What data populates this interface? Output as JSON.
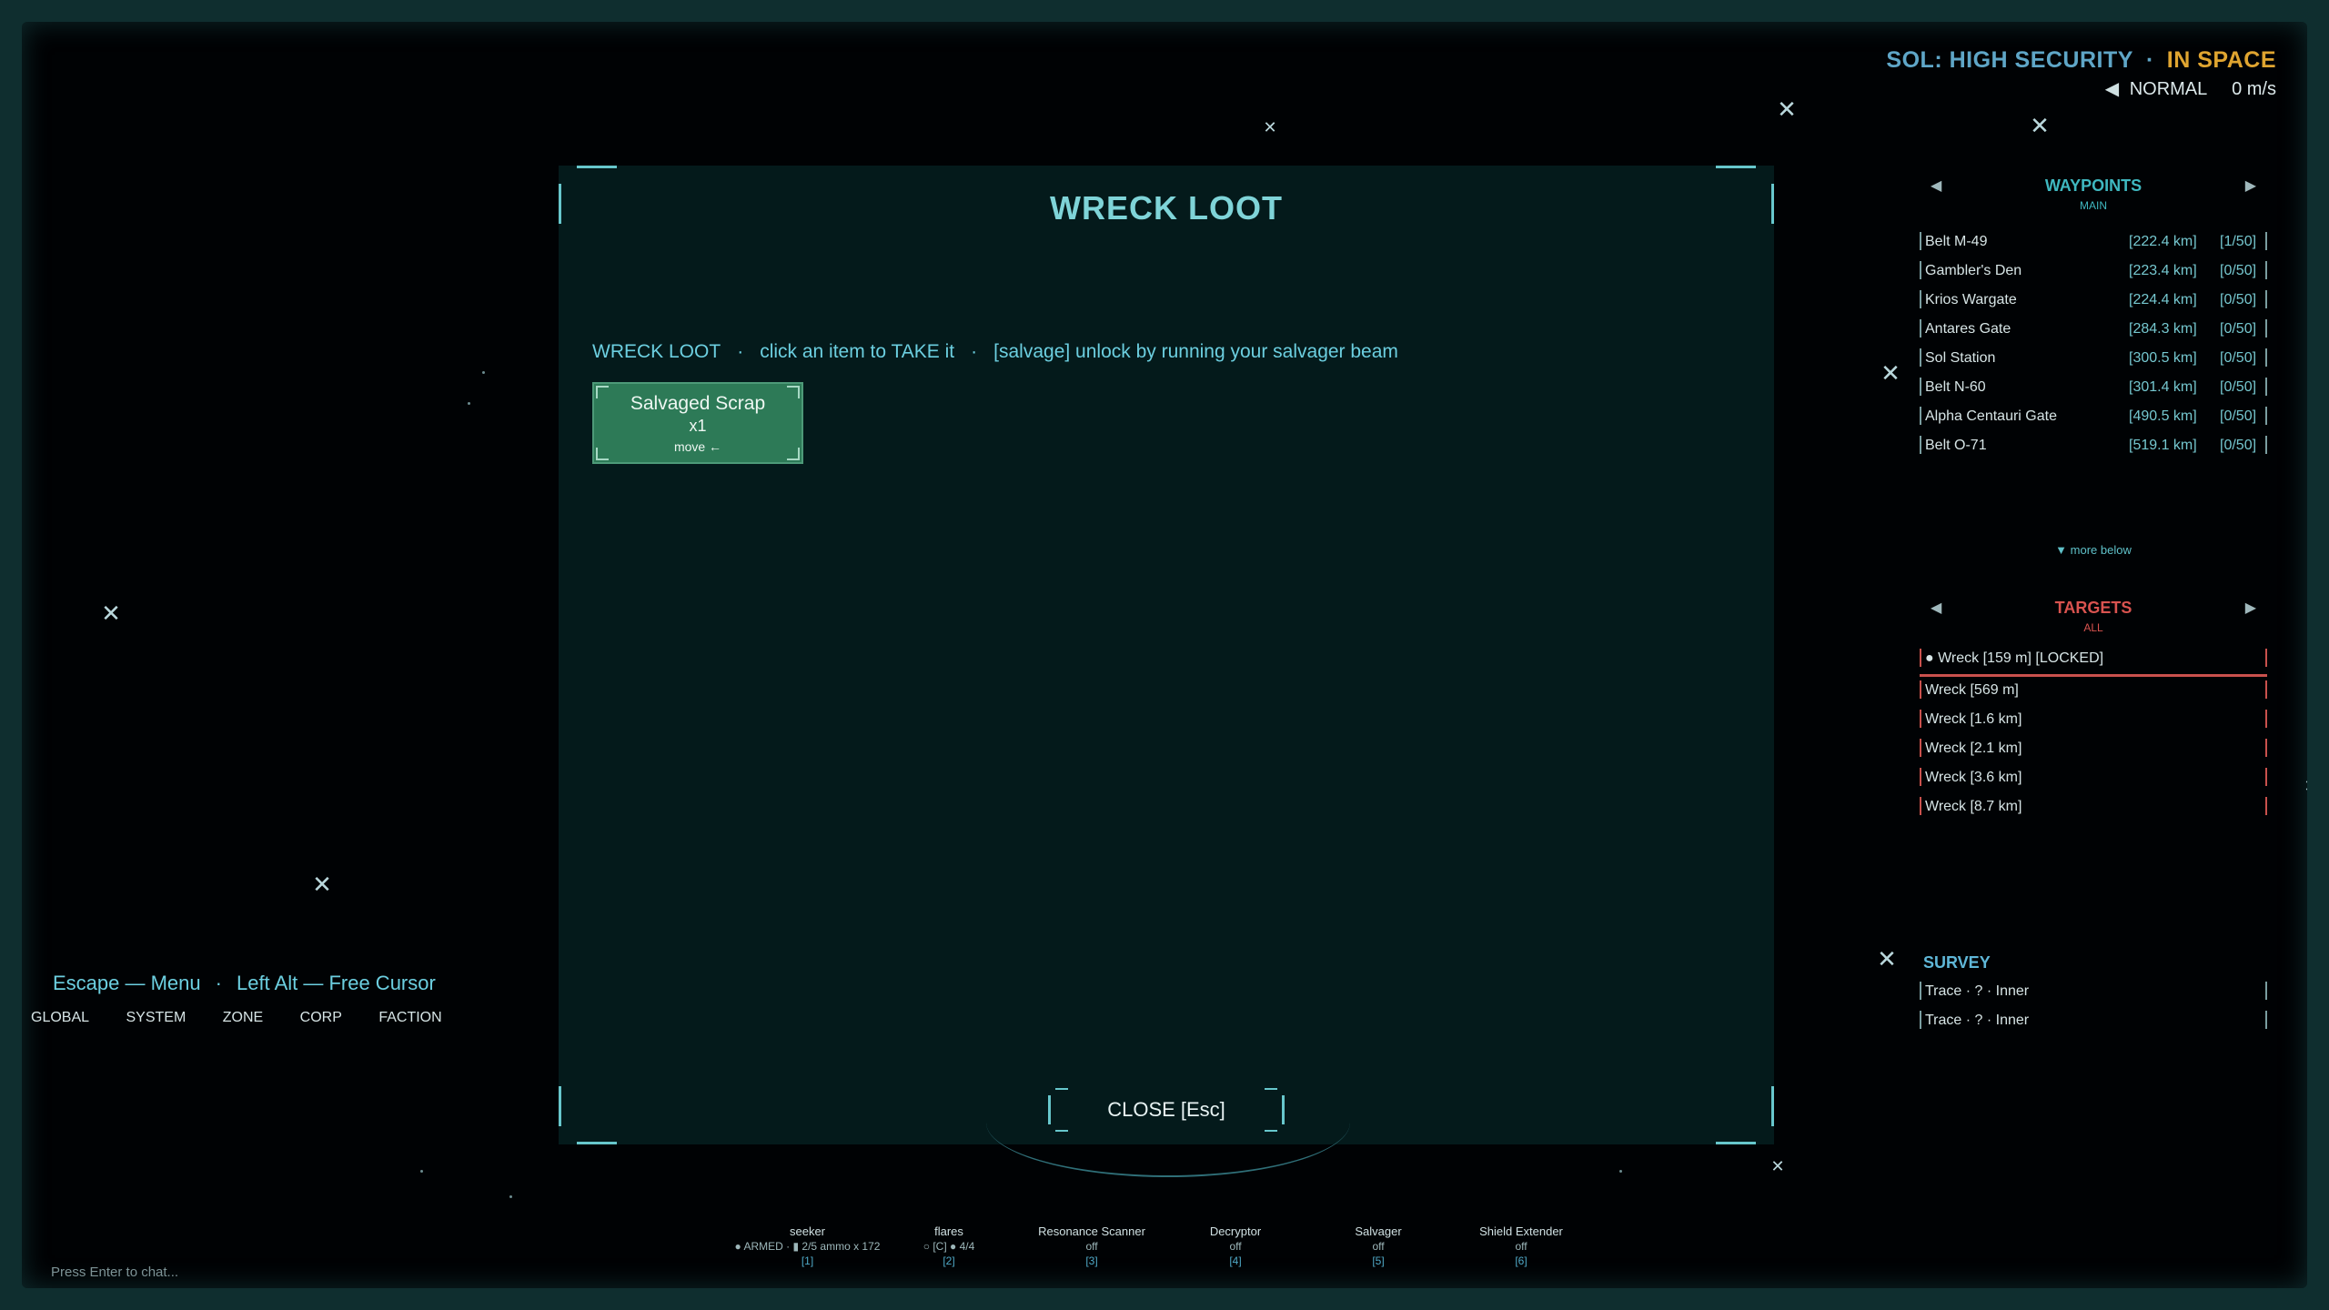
{
  "system": {
    "name": "SOL: HIGH SECURITY",
    "separator": "·",
    "state": "IN SPACE",
    "mode_arrow": "◀",
    "mode": "NORMAL",
    "speed": "0 m/s"
  },
  "loot": {
    "title": "WRECK LOOT",
    "help_label": "WRECK LOOT",
    "sep": "·",
    "help_action": "click an item to TAKE it",
    "help_salvage": "[salvage] unlock by running your salvager beam",
    "item": {
      "name": "Salvaged Scrap",
      "qty": "x1",
      "move": "move ←"
    },
    "close_label": "CLOSE [Esc]"
  },
  "waypoints": {
    "title": "WAYPOINTS",
    "sub": "MAIN",
    "prev": "◀",
    "next": "▶",
    "more": "▼ more below",
    "items": [
      {
        "name": "Belt M-49",
        "dist": "[222.4 km]",
        "cap": "[1/50]"
      },
      {
        "name": "Gambler's Den",
        "dist": "[223.4 km]",
        "cap": "[0/50]"
      },
      {
        "name": "Krios Wargate",
        "dist": "[224.4 km]",
        "cap": "[0/50]"
      },
      {
        "name": "Antares Gate",
        "dist": "[284.3 km]",
        "cap": "[0/50]"
      },
      {
        "name": "Sol Station",
        "dist": "[300.5 km]",
        "cap": "[0/50]"
      },
      {
        "name": "Belt N-60",
        "dist": "[301.4 km]",
        "cap": "[0/50]"
      },
      {
        "name": "Alpha Centauri Gate",
        "dist": "[490.5 km]",
        "cap": "[0/50]"
      },
      {
        "name": "Belt O-71",
        "dist": "[519.1 km]",
        "cap": "[0/50]"
      }
    ]
  },
  "targets": {
    "title": "TARGETS",
    "sub": "ALL",
    "prev": "◀",
    "next": "▶",
    "items": [
      "● Wreck   [159 m]   [LOCKED]",
      "Wreck   [569 m]",
      "Wreck   [1.6 km]",
      "Wreck   [2.1 km]",
      "Wreck   [3.6 km]",
      "Wreck   [8.7 km]"
    ]
  },
  "survey": {
    "title": "SURVEY",
    "items": [
      "Trace · ? · Inner",
      "Trace · ? · Inner"
    ]
  },
  "hotkeys": {
    "menu": "Escape — Menu",
    "sep": "·",
    "cursor": "Left Alt — Free Cursor"
  },
  "chat": {
    "tabs": [
      "GLOBAL",
      "SYSTEM",
      "ZONE",
      "CORP",
      "FACTION"
    ],
    "placeholder": "Press Enter to chat..."
  },
  "modules": [
    {
      "name": "seeker",
      "state": "● ARMED · ▮ 2/5  ammo x 172",
      "key": "[1]"
    },
    {
      "name": "flares",
      "state": "○ [C] ● 4/4",
      "key": "[2]"
    },
    {
      "name": "Resonance Scanner",
      "state": "off",
      "key": "[3]"
    },
    {
      "name": "Decryptor",
      "state": "off",
      "key": "[4]"
    },
    {
      "name": "Salvager",
      "state": "off",
      "key": "[5]"
    },
    {
      "name": "Shield Extender",
      "state": "off",
      "key": "[6]"
    }
  ],
  "colors": {
    "accent": "#67c7cc",
    "waypoint_title": "#3fb8c0",
    "target_title": "#d9534f",
    "state_orange": "#e0a530",
    "loot_item_bg": "#2d7a57"
  }
}
